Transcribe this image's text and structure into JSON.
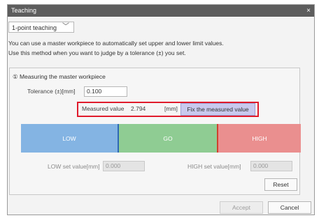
{
  "window": {
    "title": "Teaching",
    "close_glyph": "×"
  },
  "mode": {
    "selected": "1-point teaching",
    "chevron_icon": "chevron-down-icon"
  },
  "description": {
    "line1": "You can use a master workpiece to automatically set upper and lower limit values.",
    "line2": "Use this method when you want to judge by a tolerance (±) you set."
  },
  "section": {
    "title": "① Measuring the master workpiece"
  },
  "tolerance": {
    "label": "Tolerance (±)[mm]",
    "value": "0.100"
  },
  "measure": {
    "label": "Measured value",
    "value": "2.794",
    "unit": "[mm]",
    "fix_button": "Fix the measured value"
  },
  "zones": {
    "low": "LOW",
    "go": "GO",
    "high": "HIGH"
  },
  "colors": {
    "low": "#84b4e3",
    "go": "#8fcc93",
    "high": "#ea8f8f",
    "highlight": "#e01b2c"
  },
  "limits": {
    "low_label": "LOW set value[mm]",
    "low_value": "0.000",
    "high_label": "HIGH set value[mm]",
    "high_value": "0.000"
  },
  "buttons": {
    "reset": "Reset",
    "accept": "Accept",
    "cancel": "Cancel"
  }
}
